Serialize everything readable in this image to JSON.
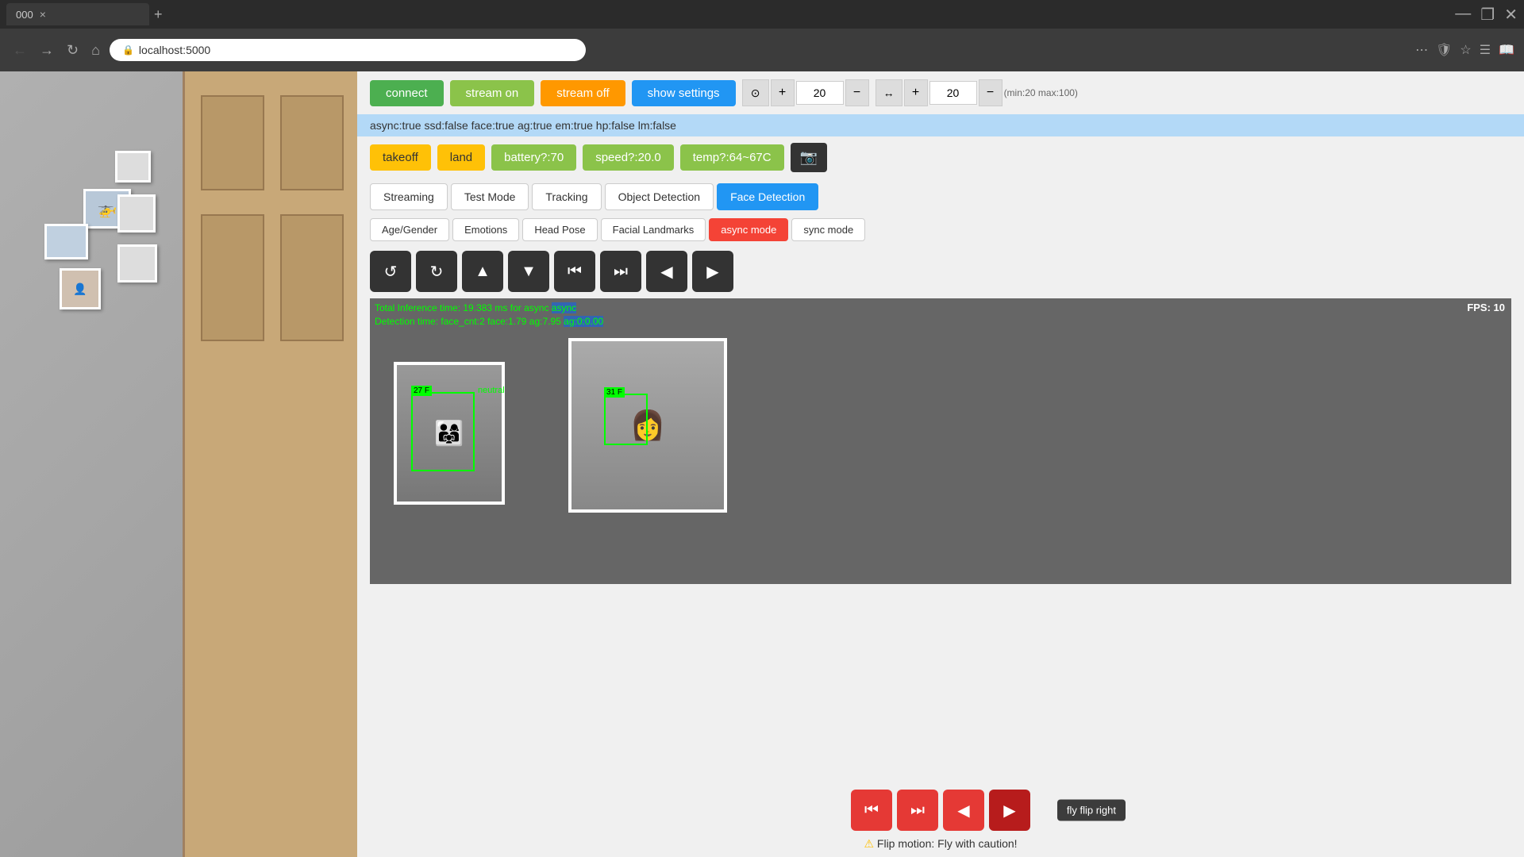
{
  "browser": {
    "tab_title": "000",
    "url": "localhost:5000",
    "tab_close": "×",
    "tab_new": "+"
  },
  "toolbar": {
    "connect_label": "connect",
    "stream_on_label": "stream on",
    "stream_off_label": "stream off",
    "show_settings_label": "show settings",
    "counter1_value": "20",
    "counter2_value": "20",
    "range_label": "(min:20 max:100)"
  },
  "status_bar": {
    "text": "async:true  ssd:false  face:true  ag:true  em:true  hp:false  lm:false"
  },
  "controls": {
    "takeoff_label": "takeoff",
    "land_label": "land",
    "battery_label": "battery?:70",
    "speed_label": "speed?:20.0",
    "temp_label": "temp?:64~67C"
  },
  "tabs": [
    {
      "label": "Streaming",
      "active": false
    },
    {
      "label": "Test Mode",
      "active": false
    },
    {
      "label": "Tracking",
      "active": false
    },
    {
      "label": "Object Detection",
      "active": false
    },
    {
      "label": "Face Detection",
      "active": true
    }
  ],
  "subtabs": [
    {
      "label": "Age/Gender",
      "active": false
    },
    {
      "label": "Emotions",
      "active": false
    },
    {
      "label": "Head Pose",
      "active": false
    },
    {
      "label": "Facial Landmarks",
      "active": false
    },
    {
      "label": "async mode",
      "active": true,
      "color": "red"
    },
    {
      "label": "sync mode",
      "active": false
    }
  ],
  "direction_btns": [
    "↺",
    "↻",
    "↑",
    "↓",
    "⏮",
    "⏭",
    "←",
    "→"
  ],
  "video": {
    "fps_label": "FPS:  10",
    "inference_line1": "Total Inference time: 19.383 ms for async",
    "inference_line2": "Detection time: face_cnt:2  face:1.79  ag:7.95",
    "inference_line2_highlight": "ag:0:0.00",
    "face1_label": "27 F",
    "face1_emotion": "neutral",
    "face2_label": "31 F"
  },
  "bottom": {
    "flip_right_tooltip": "fly flip right",
    "warning_text": "⚠ Flip motion: Fly with caution!"
  }
}
